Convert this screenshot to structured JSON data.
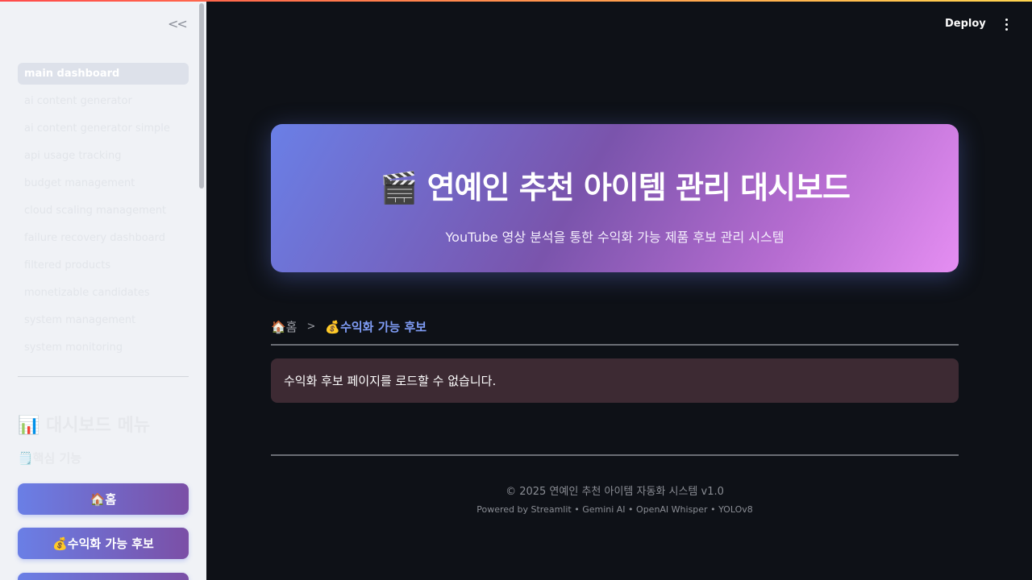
{
  "sidebar": {
    "collapse_label": "<<",
    "nav_items": [
      "main dashboard",
      "ai content generator",
      "ai content generator simple",
      "api usage tracking",
      "budget management",
      "cloud scaling management",
      "failure recovery dashboard",
      "filtered products",
      "monetizable candidates",
      "system management",
      "system monitoring"
    ],
    "active_index": 0,
    "menu_title": "📊 대시보드 메뉴",
    "section_title": "🗒️핵심 기능",
    "buttons": [
      "🏠홈",
      "💰수익화 가능 후보"
    ]
  },
  "header": {
    "deploy_label": "Deploy",
    "menu_icon": "kebab-menu-icon"
  },
  "hero": {
    "title": "🎬 연예인 추천 아이템 관리 대시보드",
    "subtitle": "YouTube 영상 분석을 통한 수익화 가능 제품 후보 관리 시스템"
  },
  "breadcrumb": {
    "home": "🏠홈",
    "separator": ">",
    "current": "💰수익화 가능 후보"
  },
  "alert": {
    "message": "수익화 후보 페이지를 로드할 수 없습니다."
  },
  "footer": {
    "copyright": "© 2025 연예인 추천 아이템 자동화 시스템 v1.0",
    "powered_by": "Powered by Streamlit • Gemini AI • OpenAI Whisper • YOLOv8"
  },
  "colors": {
    "accent": "#667eea",
    "accent_2": "#764ba2",
    "background": "#0e1117",
    "sidebar_bg": "#f0f2f6",
    "alert_bg": "#3d2a33"
  }
}
